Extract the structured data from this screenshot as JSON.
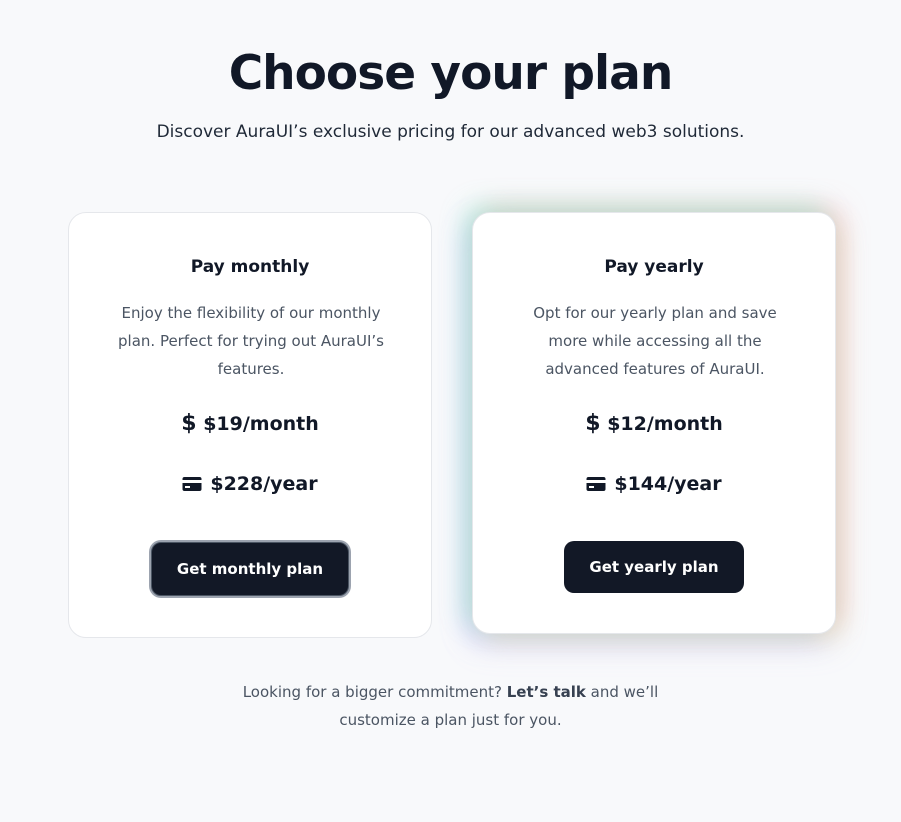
{
  "header": {
    "title": "Choose your plan",
    "subtitle": "Discover AuraUI’s exclusive pricing for our advanced web3 solutions."
  },
  "plans": [
    {
      "heading": "Pay monthly",
      "description": "Enjoy the flexibility of our monthly plan. Perfect for trying out AuraUI’s features.",
      "price_month": "$19/month",
      "price_year": "$228/year",
      "cta_label": "Get monthly plan",
      "price_month_icon": "dollar-icon",
      "price_year_icon": "credit-card-icon"
    },
    {
      "heading": "Pay yearly",
      "description": "Opt for our yearly plan and save more while accessing all the advanced features of AuraUI.",
      "price_month": "$12/month",
      "price_year": "$144/year",
      "cta_label": "Get yearly plan",
      "price_month_icon": "dollar-icon",
      "price_year_icon": "credit-card-icon"
    }
  ],
  "footer": {
    "text_before": "Looking for a bigger commitment? ",
    "link_label": "Let’s talk",
    "text_after": " and we’ll customize a plan just for you."
  },
  "colors": {
    "background": "#f8f9fb",
    "button": "#121826",
    "text_primary": "#111827",
    "text_secondary": "#4b5563"
  }
}
